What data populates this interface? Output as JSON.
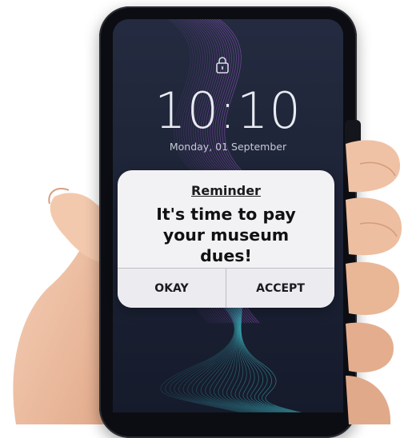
{
  "lockscreen": {
    "time": "10:10",
    "date": "Monday, 01 September",
    "lock_icon": "lock-icon"
  },
  "notification": {
    "title": "Reminder",
    "message": "It's time to pay your museum dues!",
    "buttons": [
      "OKAY",
      "ACCEPT"
    ]
  },
  "colors": {
    "screen_bg": "#1d2436",
    "wave_purple": "#a15cd1",
    "wave_teal": "#3fb8c4",
    "dialog_bg": "#f2f2f4",
    "skin": "#f0c3a6"
  }
}
